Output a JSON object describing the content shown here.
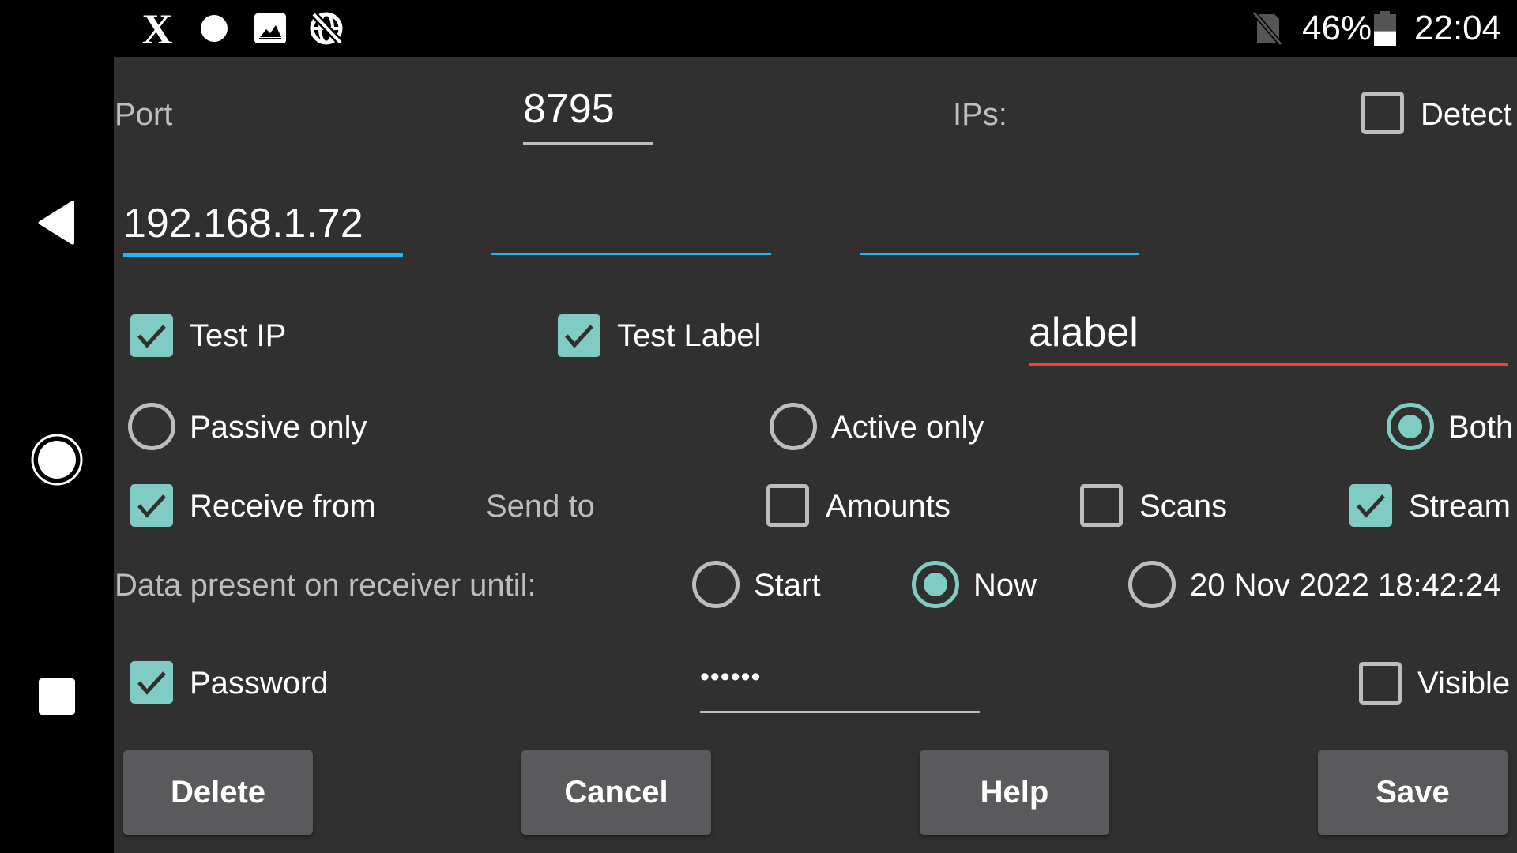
{
  "status_bar": {
    "left_icons": [
      "x-app-icon",
      "circle-notification-icon",
      "image-icon",
      "globe-off-icon"
    ],
    "sim_icon": "no-sim-icon",
    "battery_percent": "46%",
    "battery_level": 0.46,
    "time": "22:04"
  },
  "nav_bar": {
    "back": "back-icon",
    "home": "home-icon",
    "recents": "recents-icon"
  },
  "form": {
    "port_label": "Port",
    "port_value": "8795",
    "ips_label": "IPs:",
    "detect": {
      "label": "Detect",
      "checked": false
    },
    "ip_fields": [
      {
        "value": "192.168.1.72",
        "focused": true
      },
      {
        "value": "",
        "focused": false
      },
      {
        "value": "",
        "focused": false
      }
    ],
    "test_ip": {
      "label": "Test IP",
      "checked": true
    },
    "test_label": {
      "label": "Test Label",
      "checked": true
    },
    "label_value": "alabel",
    "mode_radios": [
      {
        "label": "Passive only",
        "selected": false
      },
      {
        "label": "Active only",
        "selected": false
      },
      {
        "label": "Both",
        "selected": true
      }
    ],
    "receive_from": {
      "label": "Receive from",
      "checked": true
    },
    "send_to_label": "Send to",
    "amounts": {
      "label": "Amounts",
      "checked": false
    },
    "scans": {
      "label": "Scans",
      "checked": false
    },
    "stream": {
      "label": "Stream",
      "checked": true
    },
    "data_until_label": "Data present on receiver until:",
    "until_radios": [
      {
        "label": "Start",
        "selected": false
      },
      {
        "label": "Now",
        "selected": true
      },
      {
        "label": "20 Nov 2022 18:42:24",
        "selected": false
      }
    ],
    "password": {
      "label": "Password",
      "checked": true,
      "value": "••••••"
    },
    "visible": {
      "label": "Visible",
      "checked": false
    }
  },
  "buttons": {
    "delete": "Delete",
    "cancel": "Cancel",
    "help": "Help",
    "save": "Save"
  },
  "colors": {
    "accent": "#80cbc4",
    "focus_underline": "#29b6f6",
    "error_underline": "#f44336",
    "background": "#303030",
    "button": "#5a5a5c"
  }
}
